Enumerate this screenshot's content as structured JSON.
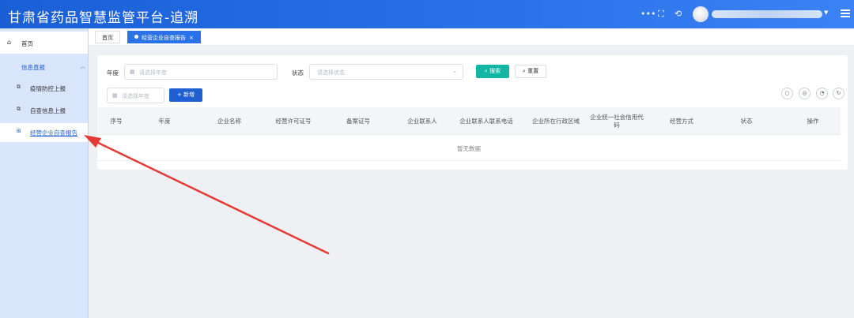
{
  "header": {
    "app_title": "甘肃省药品智慧监管平台-追溯",
    "icons": [
      "more-icon",
      "fullscreen-icon",
      "share-icon"
    ]
  },
  "sidebar": {
    "home_label": "首页",
    "group_label": "信息直报",
    "items": [
      {
        "label": "疫情防控上报",
        "icon": "report-icon"
      },
      {
        "label": "自查信息上报",
        "icon": "report-icon"
      },
      {
        "label": "经营企业自查报告",
        "icon": "grid-icon",
        "active": true
      }
    ]
  },
  "tabs": [
    {
      "label": "首页",
      "active": false
    },
    {
      "label": "经营企业自查报告",
      "active": true
    }
  ],
  "filters": {
    "year_label": "年度",
    "year_placeholder": "请选择年度",
    "status_label": "状态",
    "status_placeholder": "请选择状态",
    "search_btn": "搜索",
    "reset_btn": "重置",
    "year_placeholder_2": "请选择年度",
    "add_btn": "+ 新增"
  },
  "table": {
    "columns": [
      "序号",
      "年度",
      "企业名称",
      "经营许可证号",
      "备案证号",
      "企业联系人",
      "企业联系人联系电话",
      "企业所在行政区域",
      "企业统一社会信用代码",
      "经营方式",
      "状态",
      "操作"
    ],
    "empty_text": "暂无数据"
  },
  "colors": {
    "header": "#1a5fd6",
    "primary": "#1f5fd1",
    "teal": "#13b5a5",
    "arrow": "#e53935"
  }
}
